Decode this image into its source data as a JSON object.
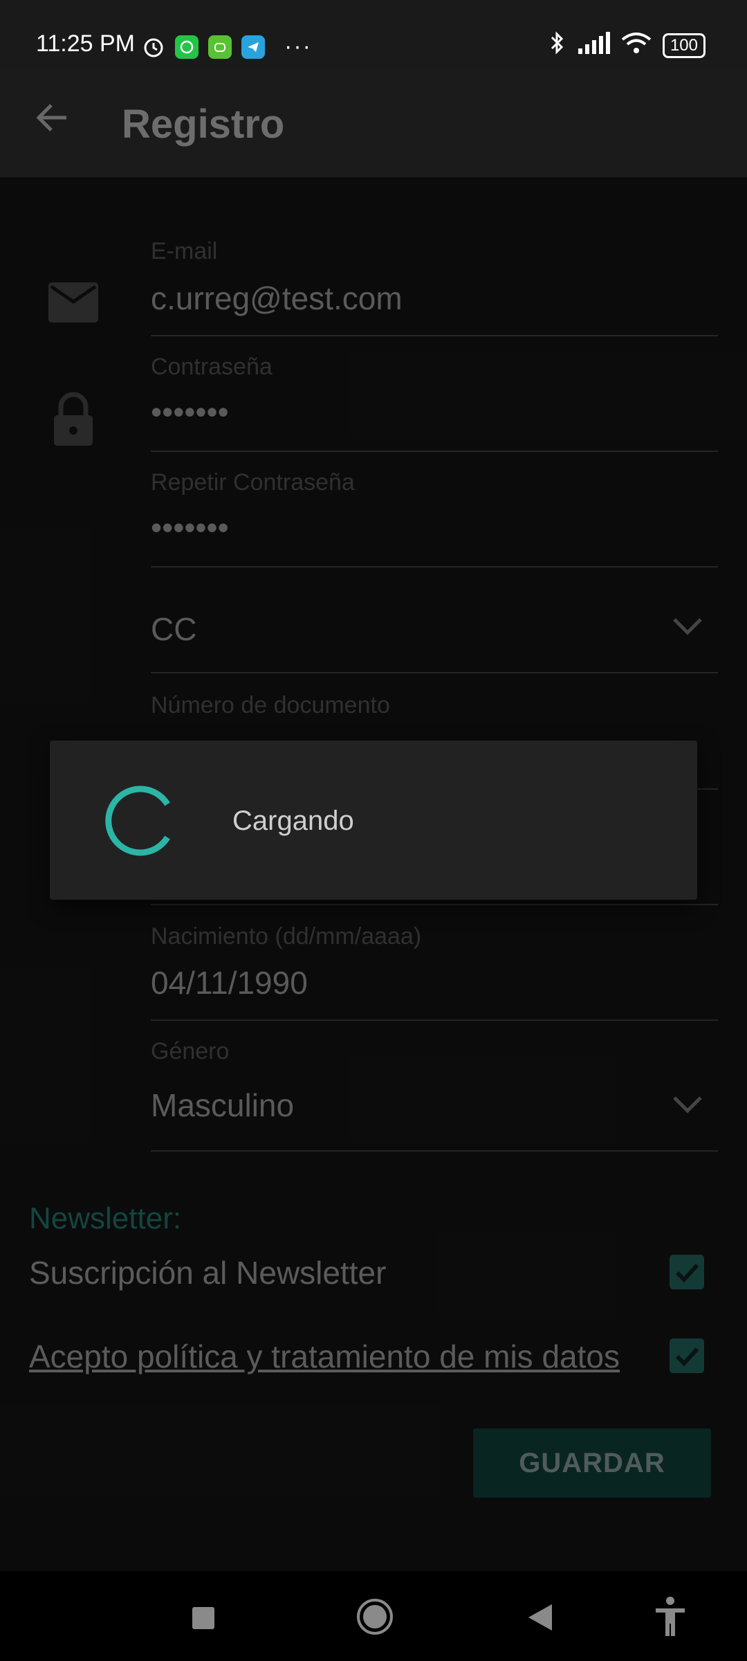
{
  "status_bar": {
    "time": "11:25 PM",
    "battery": "100",
    "icons": [
      "alarm-icon",
      "whatsapp-icon",
      "bot-icon",
      "telegram-icon",
      "more-icon",
      "bluetooth-icon",
      "signal-icon",
      "wifi-icon",
      "battery-icon"
    ]
  },
  "app_bar": {
    "title": "Registro",
    "back_icon": "arrow-back-icon"
  },
  "form": {
    "email": {
      "label": "E-mail",
      "value": "c.urreg@test.com"
    },
    "password": {
      "label": "Contraseña",
      "value": "•••••••"
    },
    "repeat_password": {
      "label": "Repetir Contraseña",
      "value": "•••••••"
    },
    "doc_type": {
      "value": "CC"
    },
    "doc_number": {
      "label": "Número de documento"
    },
    "birth": {
      "label": "Nacimiento (dd/mm/aaaa)",
      "value": "04/11/1990"
    },
    "gender": {
      "label": "Género",
      "value": "Masculino"
    }
  },
  "newsletter": {
    "title": "Newsletter:",
    "subscription_label": "Suscripción al Newsletter",
    "subscription_checked": true,
    "policy_label": "Acepto política y tratamiento de mis datos",
    "policy_checked": true
  },
  "save_button": "GUARDAR",
  "dialog": {
    "message": "Cargando"
  },
  "colors": {
    "accent": "#2bb5a6",
    "checkbox": "#1f5a54",
    "button": "#0d3a35"
  }
}
